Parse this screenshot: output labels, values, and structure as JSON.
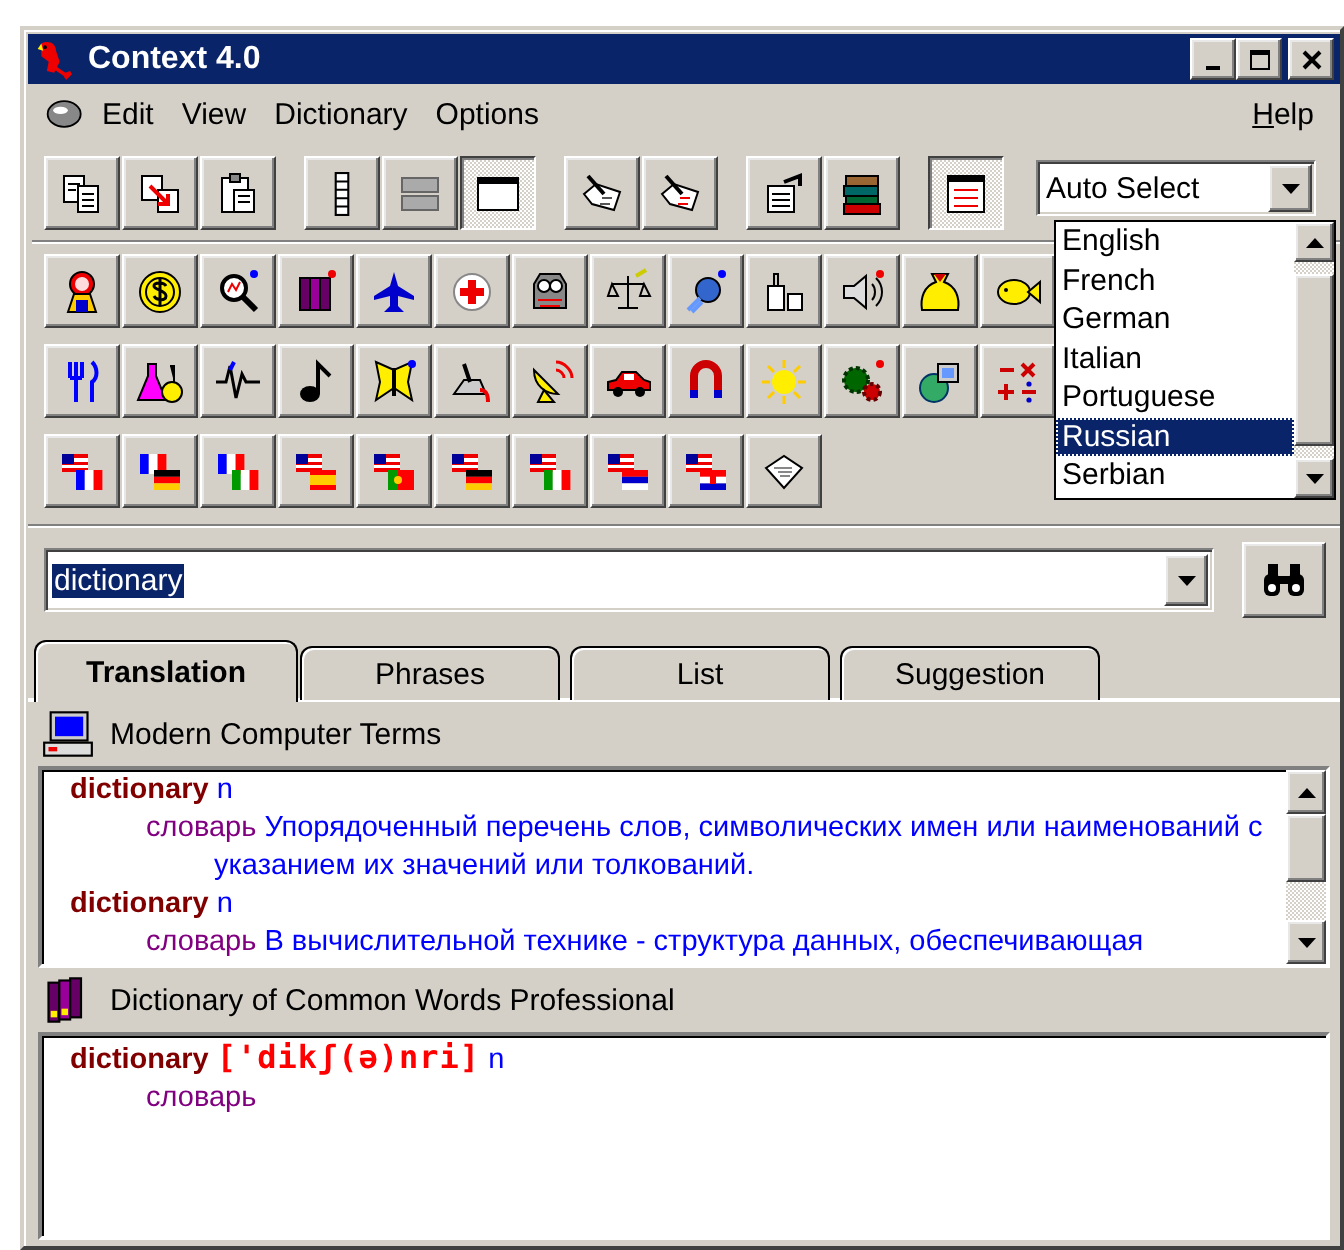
{
  "window": {
    "title": "Context 4.0"
  },
  "menu": {
    "items": [
      {
        "label": "Edit"
      },
      {
        "label": "View"
      },
      {
        "label": "Dictionary"
      },
      {
        "label": "Options"
      }
    ],
    "help": {
      "label": "Help"
    }
  },
  "toolbar": {
    "rows": [
      [
        [
          {
            "pressed": false
          },
          {
            "pressed": false
          },
          {
            "pressed": false
          }
        ],
        [
          {
            "pressed": false
          },
          {
            "pressed": false
          },
          {
            "pressed": true
          }
        ],
        [
          {
            "pressed": false
          },
          {
            "pressed": false
          }
        ],
        [
          {
            "pressed": false
          },
          {
            "pressed": false
          }
        ],
        [
          {
            "pressed": true
          }
        ]
      ],
      [
        [
          {
            "pressed": false
          },
          {
            "pressed": false
          },
          {
            "pressed": false
          },
          {
            "pressed": false
          },
          {
            "pressed": false
          },
          {
            "pressed": false
          },
          {
            "pressed": false
          },
          {
            "pressed": false
          },
          {
            "pressed": false
          },
          {
            "pressed": false
          },
          {
            "pressed": false
          },
          {
            "pressed": false
          },
          {
            "pressed": false
          }
        ]
      ],
      [
        [
          {
            "pressed": false
          },
          {
            "pressed": false
          },
          {
            "pressed": false
          },
          {
            "pressed": false
          },
          {
            "pressed": false
          },
          {
            "pressed": false
          },
          {
            "pressed": false
          },
          {
            "pressed": false
          },
          {
            "pressed": false
          },
          {
            "pressed": false
          },
          {
            "pressed": false
          },
          {
            "pressed": false
          },
          {
            "pressed": false
          }
        ]
      ],
      [
        [
          {
            "pressed": false
          },
          {
            "pressed": false
          },
          {
            "pressed": false
          },
          {
            "pressed": false
          },
          {
            "pressed": false
          },
          {
            "pressed": false
          },
          {
            "pressed": false
          },
          {
            "pressed": false
          },
          {
            "pressed": false
          },
          {
            "pressed": false
          }
        ]
      ]
    ]
  },
  "language_select": {
    "value": "Auto Select",
    "options": [
      {
        "label": "English",
        "selected": false
      },
      {
        "label": "French",
        "selected": false
      },
      {
        "label": "German",
        "selected": false
      },
      {
        "label": "Italian",
        "selected": false
      },
      {
        "label": "Portuguese",
        "selected": false
      },
      {
        "label": "Russian",
        "selected": true
      },
      {
        "label": "Serbian",
        "selected": false
      }
    ]
  },
  "search": {
    "value": "dictionary"
  },
  "tabs": [
    {
      "label": "Translation",
      "selected": true
    },
    {
      "label": "Phrases",
      "selected": false
    },
    {
      "label": "List",
      "selected": false
    },
    {
      "label": "Suggestion",
      "selected": false
    }
  ],
  "dictionaries": [
    {
      "kind": "computer",
      "title": "Modern Computer Terms",
      "entries": [
        {
          "headword": "dictionary",
          "pos": "n",
          "senses": [
            {
              "translation": "словарь",
              "definition": "Упорядоченный перечень слов, символических имен или наименований с указанием их значений или толкований."
            }
          ]
        },
        {
          "headword": "dictionary",
          "pos": "n",
          "senses": [
            {
              "translation": "словарь",
              "definition": "В вычислительной технике - структура данных, обеспечивающая"
            }
          ]
        }
      ]
    },
    {
      "kind": "books",
      "title": "Dictionary of Common Words Professional",
      "entries": [
        {
          "headword": "dictionary",
          "transcription": "['dikʃ(ə)nri]",
          "pos": "n",
          "senses": [
            {
              "translation": "словарь"
            }
          ]
        }
      ]
    }
  ]
}
